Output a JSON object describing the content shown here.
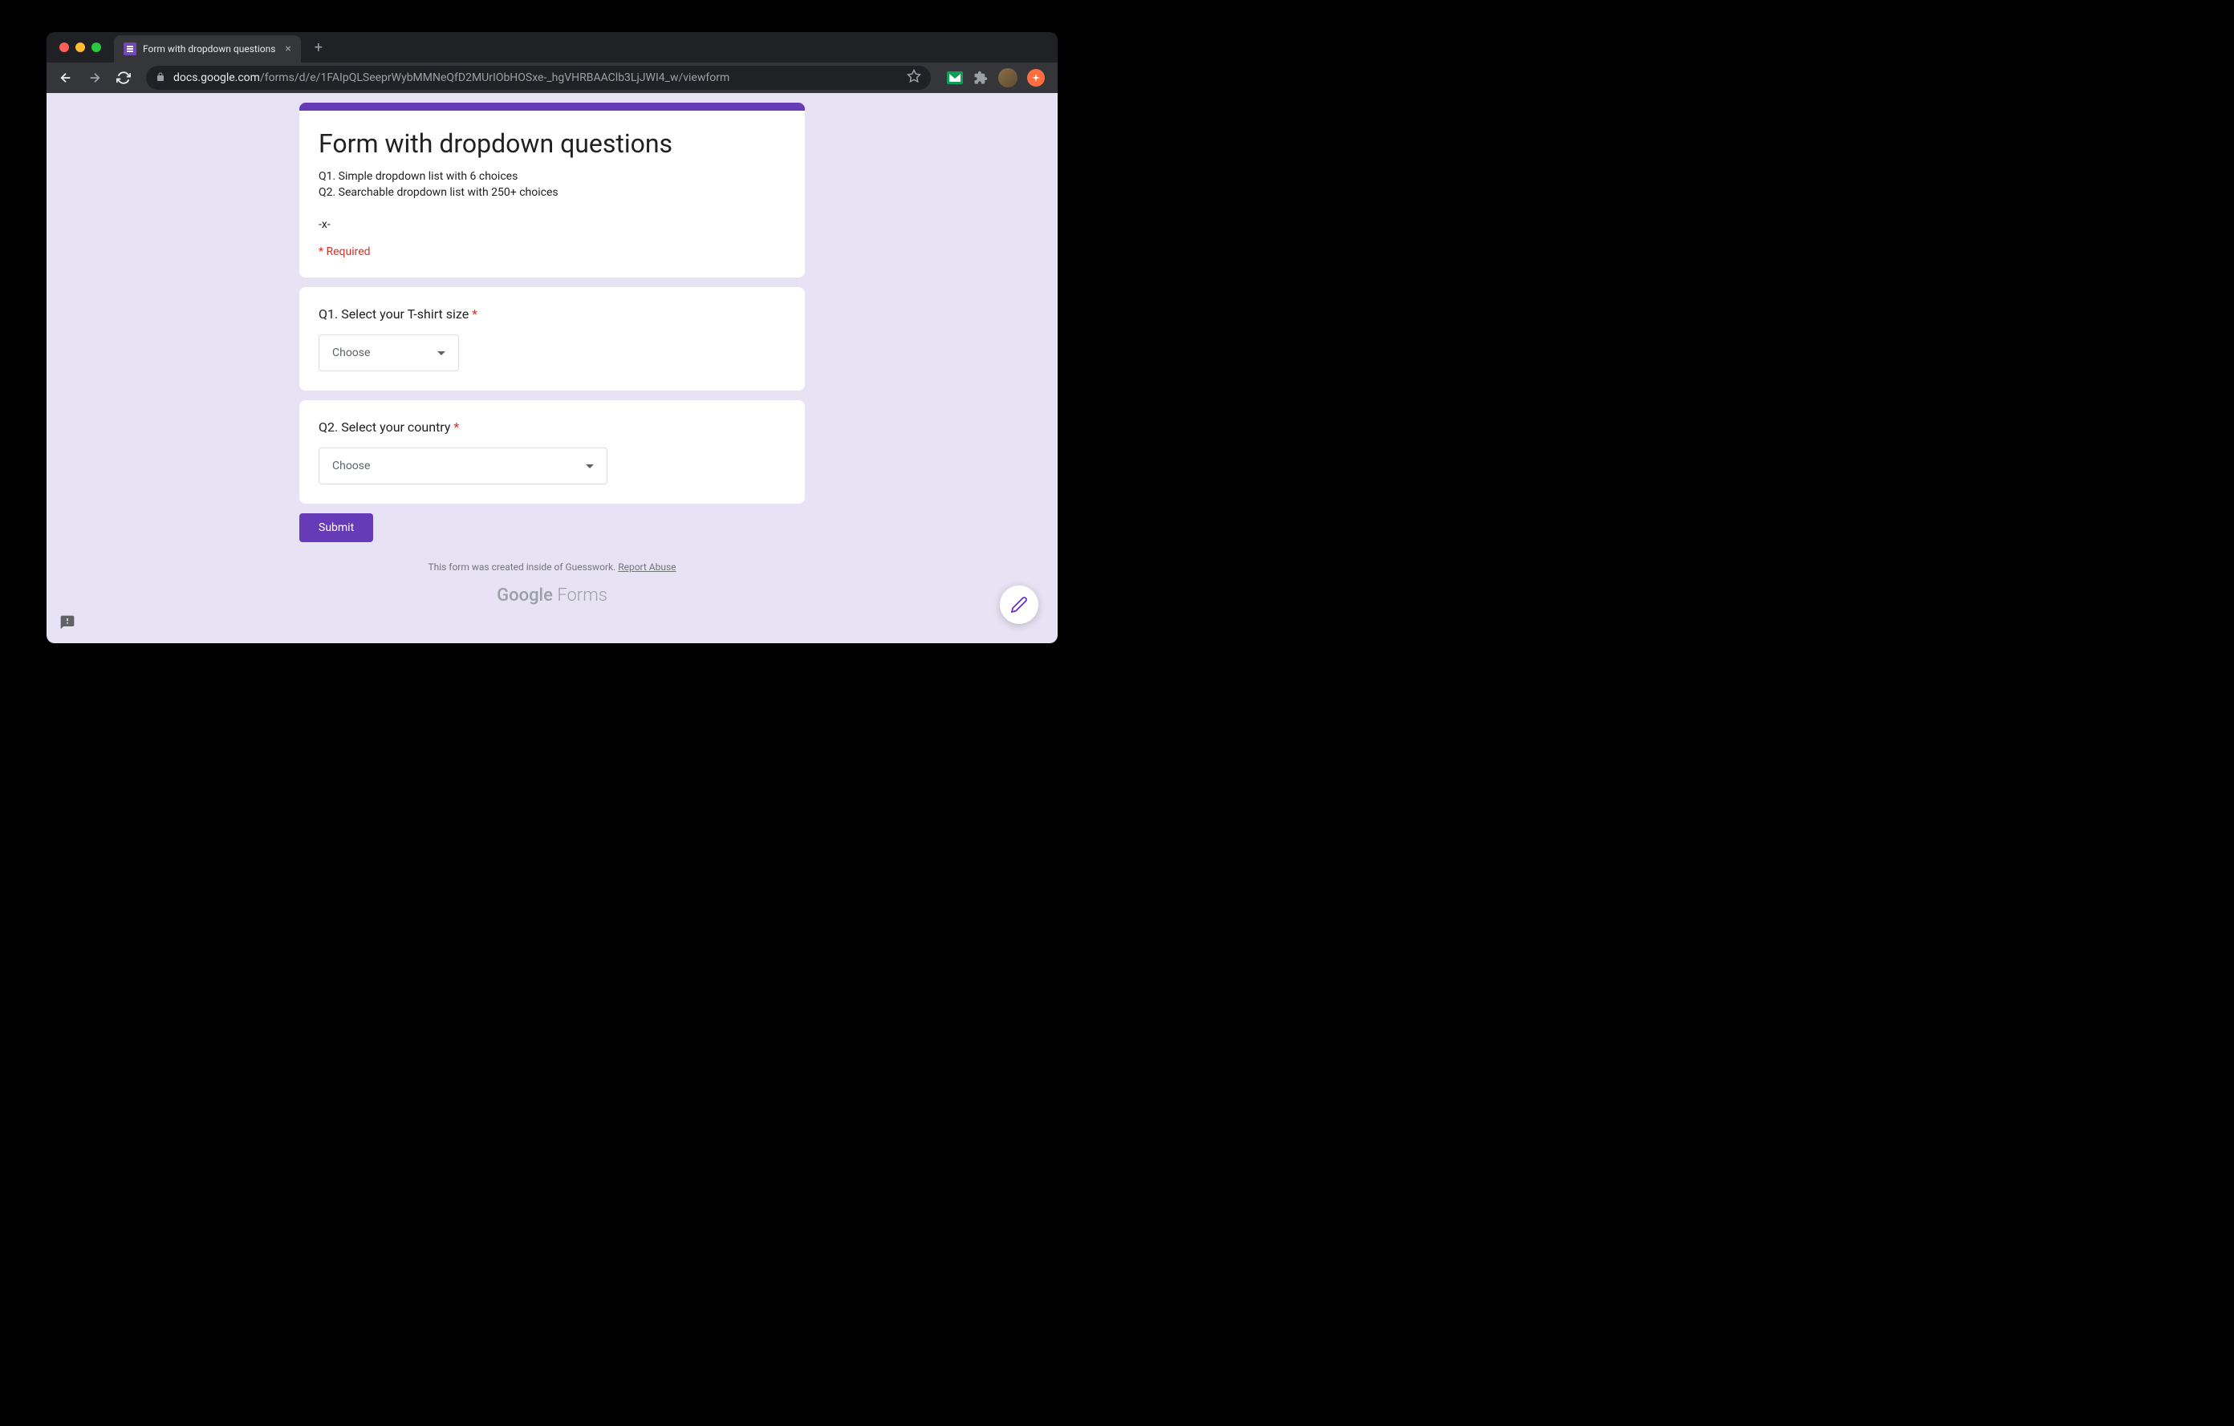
{
  "browser": {
    "tab_title": "Form with dropdown questions",
    "url_domain": "docs.google.com",
    "url_path": "/forms/d/e/1FAIpQLSeeprWybMMNeQfD2MUrIObHOSxe-_hgVHRBAAClb3LjJWI4_w/viewform"
  },
  "form": {
    "title": "Form with dropdown questions",
    "description": "Q1. Simple dropdown list with 6 choices\nQ2. Searchable dropdown list with 250+ choices\n\n-x-",
    "required_label": "* Required",
    "questions": [
      {
        "label": "Q1. Select your T-shirt size",
        "required": true,
        "placeholder": "Choose"
      },
      {
        "label": "Q2. Select your country",
        "required": true,
        "placeholder": "Choose"
      }
    ],
    "submit_label": "Submit",
    "footer_text": "This form was created inside of Guesswork. ",
    "report_abuse": "Report Abuse",
    "logo_google": "Google",
    "logo_forms": " Forms"
  }
}
